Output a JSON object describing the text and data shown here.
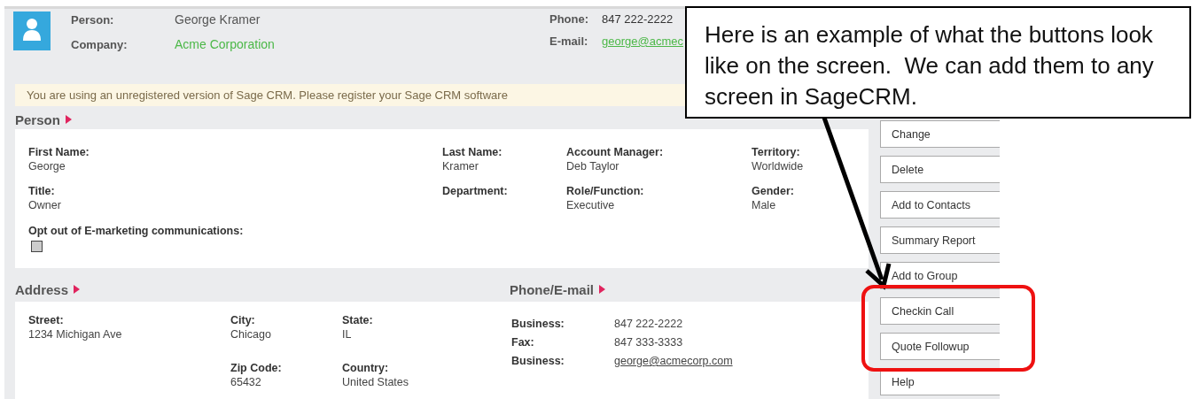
{
  "header": {
    "fields": [
      {
        "label": "Person:",
        "value": "George Kramer",
        "kind": "text"
      },
      {
        "label": "Company:",
        "value": "Acme Corporation",
        "kind": "link"
      }
    ],
    "contact": [
      {
        "label": "Phone:",
        "value": "847 222-2222",
        "kind": "text"
      },
      {
        "label": "E-mail:",
        "value": "george@acmec",
        "kind": "link"
      }
    ]
  },
  "notice": "You are using an unregistered version of Sage CRM. Please register your Sage CRM software",
  "person": {
    "title": "Person",
    "fields": [
      {
        "label": "First Name:",
        "value": "George",
        "kind": "text"
      },
      {
        "label": "Last Name:",
        "value": "Kramer",
        "kind": "text"
      },
      {
        "label": "Account Manager:",
        "value": "Deb Taylor",
        "kind": "text"
      },
      {
        "label": "Territory:",
        "value": "Worldwide",
        "kind": "text"
      },
      {
        "label": "Title:",
        "value": "Owner",
        "kind": "text"
      },
      {
        "label": "Department:",
        "kind": "text"
      },
      {
        "label": "Role/Function:",
        "value": "Executive",
        "kind": "text"
      },
      {
        "label": "Gender:",
        "value": "Male",
        "kind": "text"
      },
      {
        "label": "Opt out of E-marketing communications:",
        "kind": "checkbox",
        "checked": false
      }
    ]
  },
  "address": {
    "title": "Address",
    "fields": [
      {
        "label": "Street:",
        "value": "1234 Michigan Ave"
      },
      {
        "label": "City:",
        "value": "Chicago"
      },
      {
        "label": "State:",
        "value": "IL"
      },
      {
        "label": "Zip Code:",
        "value": "65432"
      },
      {
        "label": "Country:",
        "value": "United States"
      }
    ]
  },
  "phone_email": {
    "title": "Phone/E-mail",
    "rows": [
      {
        "label": "Business:",
        "value": "847 222-2222",
        "kind": "text"
      },
      {
        "label": "Fax:",
        "value": "847 333-3333",
        "kind": "text"
      },
      {
        "label": "Business:",
        "value": "george@acmecorp.com",
        "kind": "link"
      }
    ]
  },
  "buttons": [
    {
      "label": "Change"
    },
    {
      "label": "Delete"
    },
    {
      "label": "Add to Contacts"
    },
    {
      "label": "Summary Report"
    },
    {
      "label": "Add to Group"
    },
    {
      "label": "Checkin Call"
    },
    {
      "label": "Quote Followup"
    },
    {
      "label": "Help"
    }
  ],
  "callout": {
    "text": "Here is an example of what the buttons look like on the screen.  We can add them to any screen in SageCRM."
  }
}
